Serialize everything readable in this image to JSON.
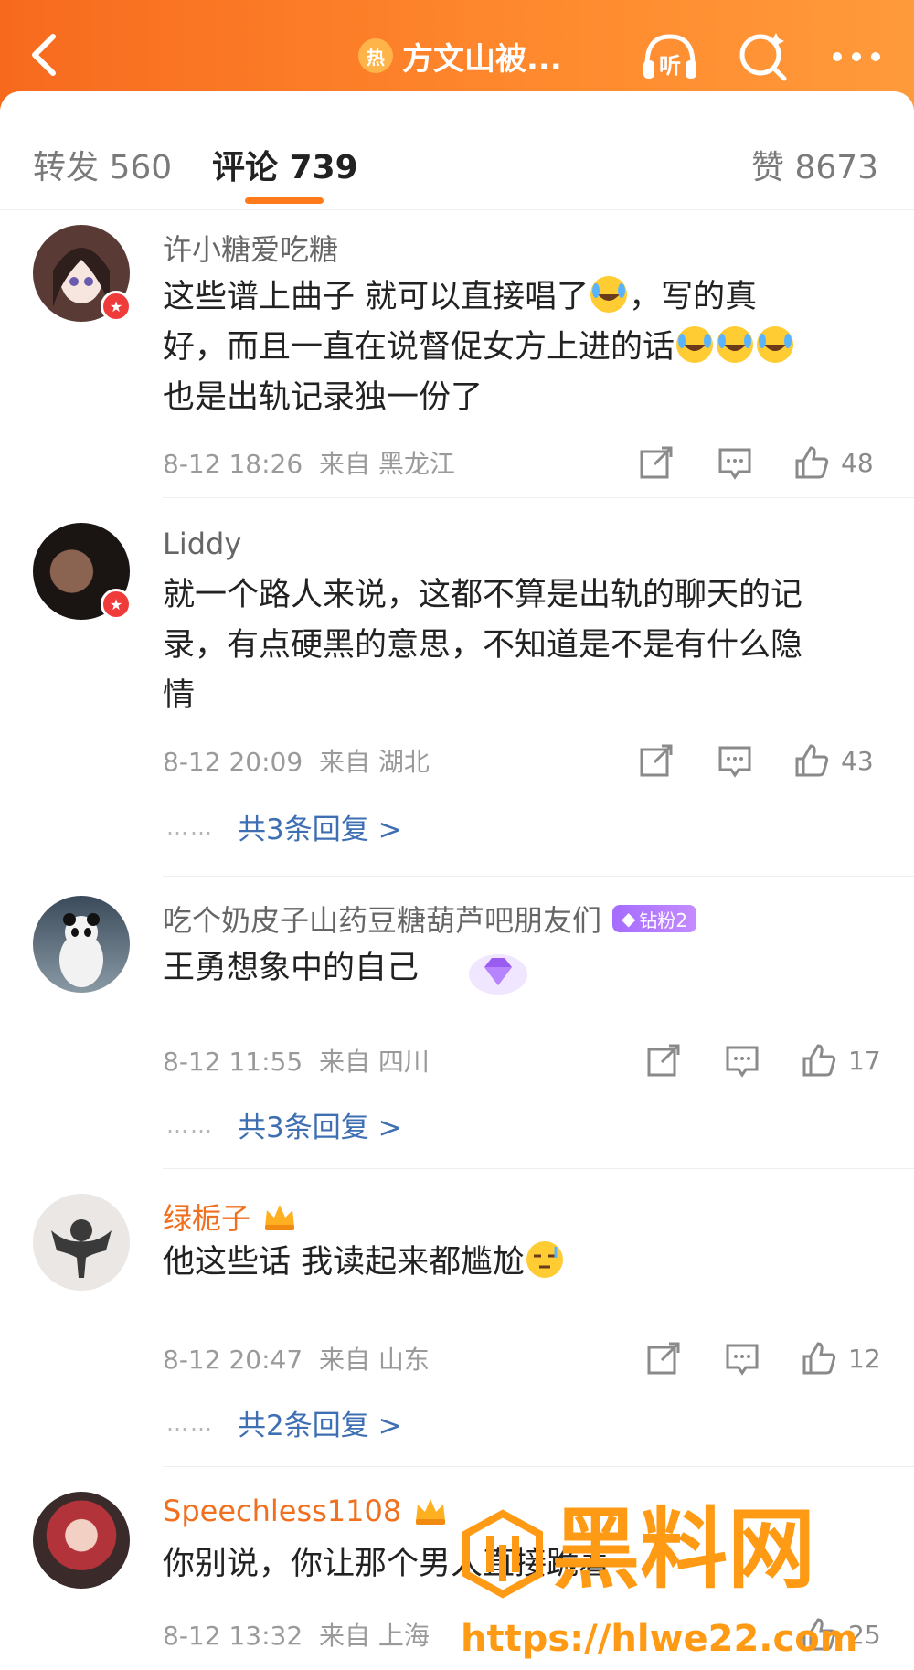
{
  "header": {
    "title": "方文山被...",
    "hot_badge": "热",
    "listen_label": "听"
  },
  "tabs": {
    "repost": "转发 560",
    "comments": "评论 739",
    "likes": "赞 8673"
  },
  "comments": [
    {
      "user": "许小糖爱吃糖",
      "text1": "这些谱上曲子 就可以直接唱了",
      "text1b": "，写的真",
      "text2": "好，而且一直在说督促女方上进的话",
      "text3": "也是出轨记录独一份了",
      "time": "8-12 18:26",
      "from": "来自",
      "location": "黑龙江",
      "likes": "48"
    },
    {
      "user": "Liddy",
      "text1": "就一个路人来说，这都不算是出轨的聊天的记",
      "text2": "录，有点硬黑的意思，不知道是不是有什么隐",
      "text3": "情",
      "time": "8-12 20:09",
      "from": "来自",
      "location": "湖北",
      "likes": "43",
      "replies": "共3条回复 >"
    },
    {
      "user": "吃个奶皮子山药豆糖葫芦吧朋友们",
      "badge": "钻粉2",
      "text1": "王勇想象中的自己",
      "time": "8-12 11:55",
      "from": "来自",
      "location": "四川",
      "likes": "17",
      "replies": "共3条回复 >"
    },
    {
      "user": "绿栀子",
      "text1": "他这些话 我读起来都尴尬",
      "time": "8-12 20:47",
      "from": "来自",
      "location": "山东",
      "likes": "12",
      "replies": "共2条回复 >"
    },
    {
      "user": "Speechless1108",
      "text1": "你别说，你让那个男人直接跪着",
      "time": "8-12 13:32",
      "from": "来自",
      "location": "上海",
      "likes": "25"
    }
  ],
  "reply_dots": "……",
  "watermark": {
    "big": "黑料网",
    "url": "https://hlwe22.com"
  },
  "colors": {
    "header": "#f76a1e",
    "accent": "#ff7a1a",
    "link": "#3f6fb3",
    "vip_name": "#f07020"
  }
}
